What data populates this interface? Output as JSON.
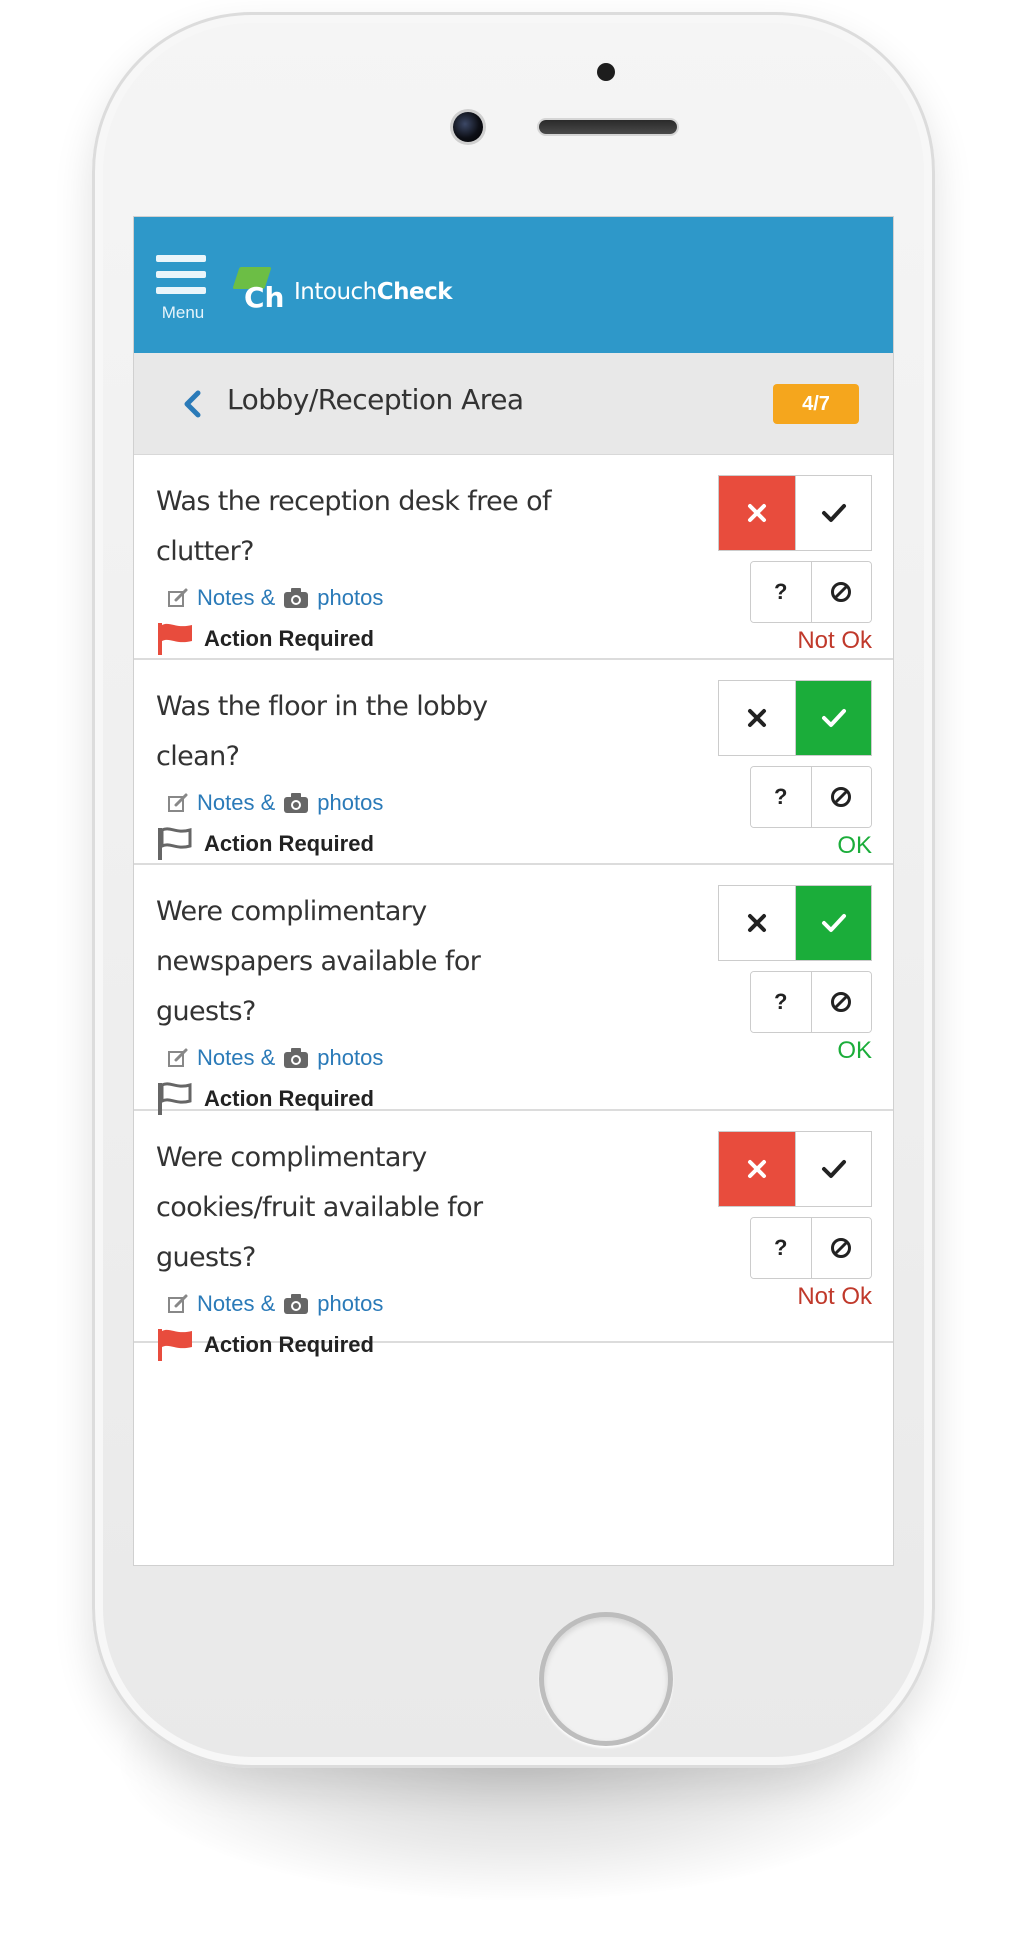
{
  "app": {
    "menu_label": "Menu",
    "logo_mark": "Ch",
    "logo_name_light": "Intouch",
    "logo_name_bold": "Check"
  },
  "section": {
    "title": "Lobby/Reception Area",
    "progress": "4/7"
  },
  "notes": {
    "notes_label": "Notes &",
    "photos_label": "photos"
  },
  "action_label": "Action Required",
  "questions": [
    {
      "text": "Was the reception desk free of clutter?",
      "answer": "no",
      "flagged": true,
      "result": "Not Ok"
    },
    {
      "text": "Was the floor in the lobby clean?",
      "answer": "yes",
      "flagged": false,
      "result": "OK"
    },
    {
      "text": "Were complimentary newspapers available for guests?",
      "answer": "yes",
      "flagged": false,
      "result": "OK"
    },
    {
      "text": "Were complimentary cookies/fruit available for guests?",
      "answer": "no",
      "flagged": true,
      "result": "Not Ok"
    }
  ],
  "buttons": {
    "unknown_symbol": "?",
    "na_symbol": "⊘"
  },
  "colors": {
    "header": "#2e98c9",
    "badge": "#f5a61d",
    "no_active": "#e84c3d",
    "yes_active": "#1bad3a",
    "flag_red": "#e84c3d",
    "link": "#2a7ab8"
  }
}
